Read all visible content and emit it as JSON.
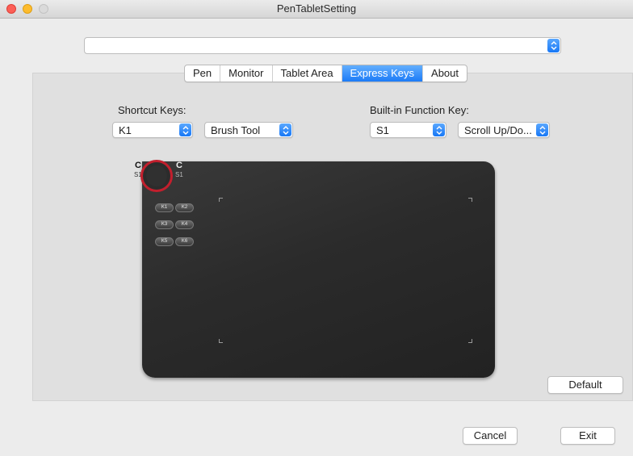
{
  "window": {
    "title": "PenTabletSetting"
  },
  "device_select": {
    "value": ""
  },
  "tabs": [
    {
      "label": "Pen",
      "active": false
    },
    {
      "label": "Monitor",
      "active": false
    },
    {
      "label": "Tablet Area",
      "active": false
    },
    {
      "label": "Express Keys",
      "active": true
    },
    {
      "label": "About",
      "active": false
    }
  ],
  "shortcut": {
    "label": "Shortcut Keys:",
    "key_value": "K1",
    "function_value": "Brush Tool"
  },
  "builtin": {
    "label": "Built-in Function Key:",
    "key_value": "S1",
    "function_value": "Scroll Up/Do..."
  },
  "tablet": {
    "dial_left_label": "S1",
    "dial_right_label": "S1",
    "dial_left_glyph": "C",
    "dial_right_glyph": "C",
    "keys": [
      {
        "left": "K1",
        "right": "K2"
      },
      {
        "left": "K3",
        "right": "K4"
      },
      {
        "left": "K5",
        "right": "K6"
      }
    ]
  },
  "buttons": {
    "default": "Default",
    "cancel": "Cancel",
    "exit": "Exit"
  },
  "colors": {
    "accent": "#1c7bf7",
    "dial_ring": "#c21f2d",
    "tablet_body": "#2b2b2b"
  }
}
